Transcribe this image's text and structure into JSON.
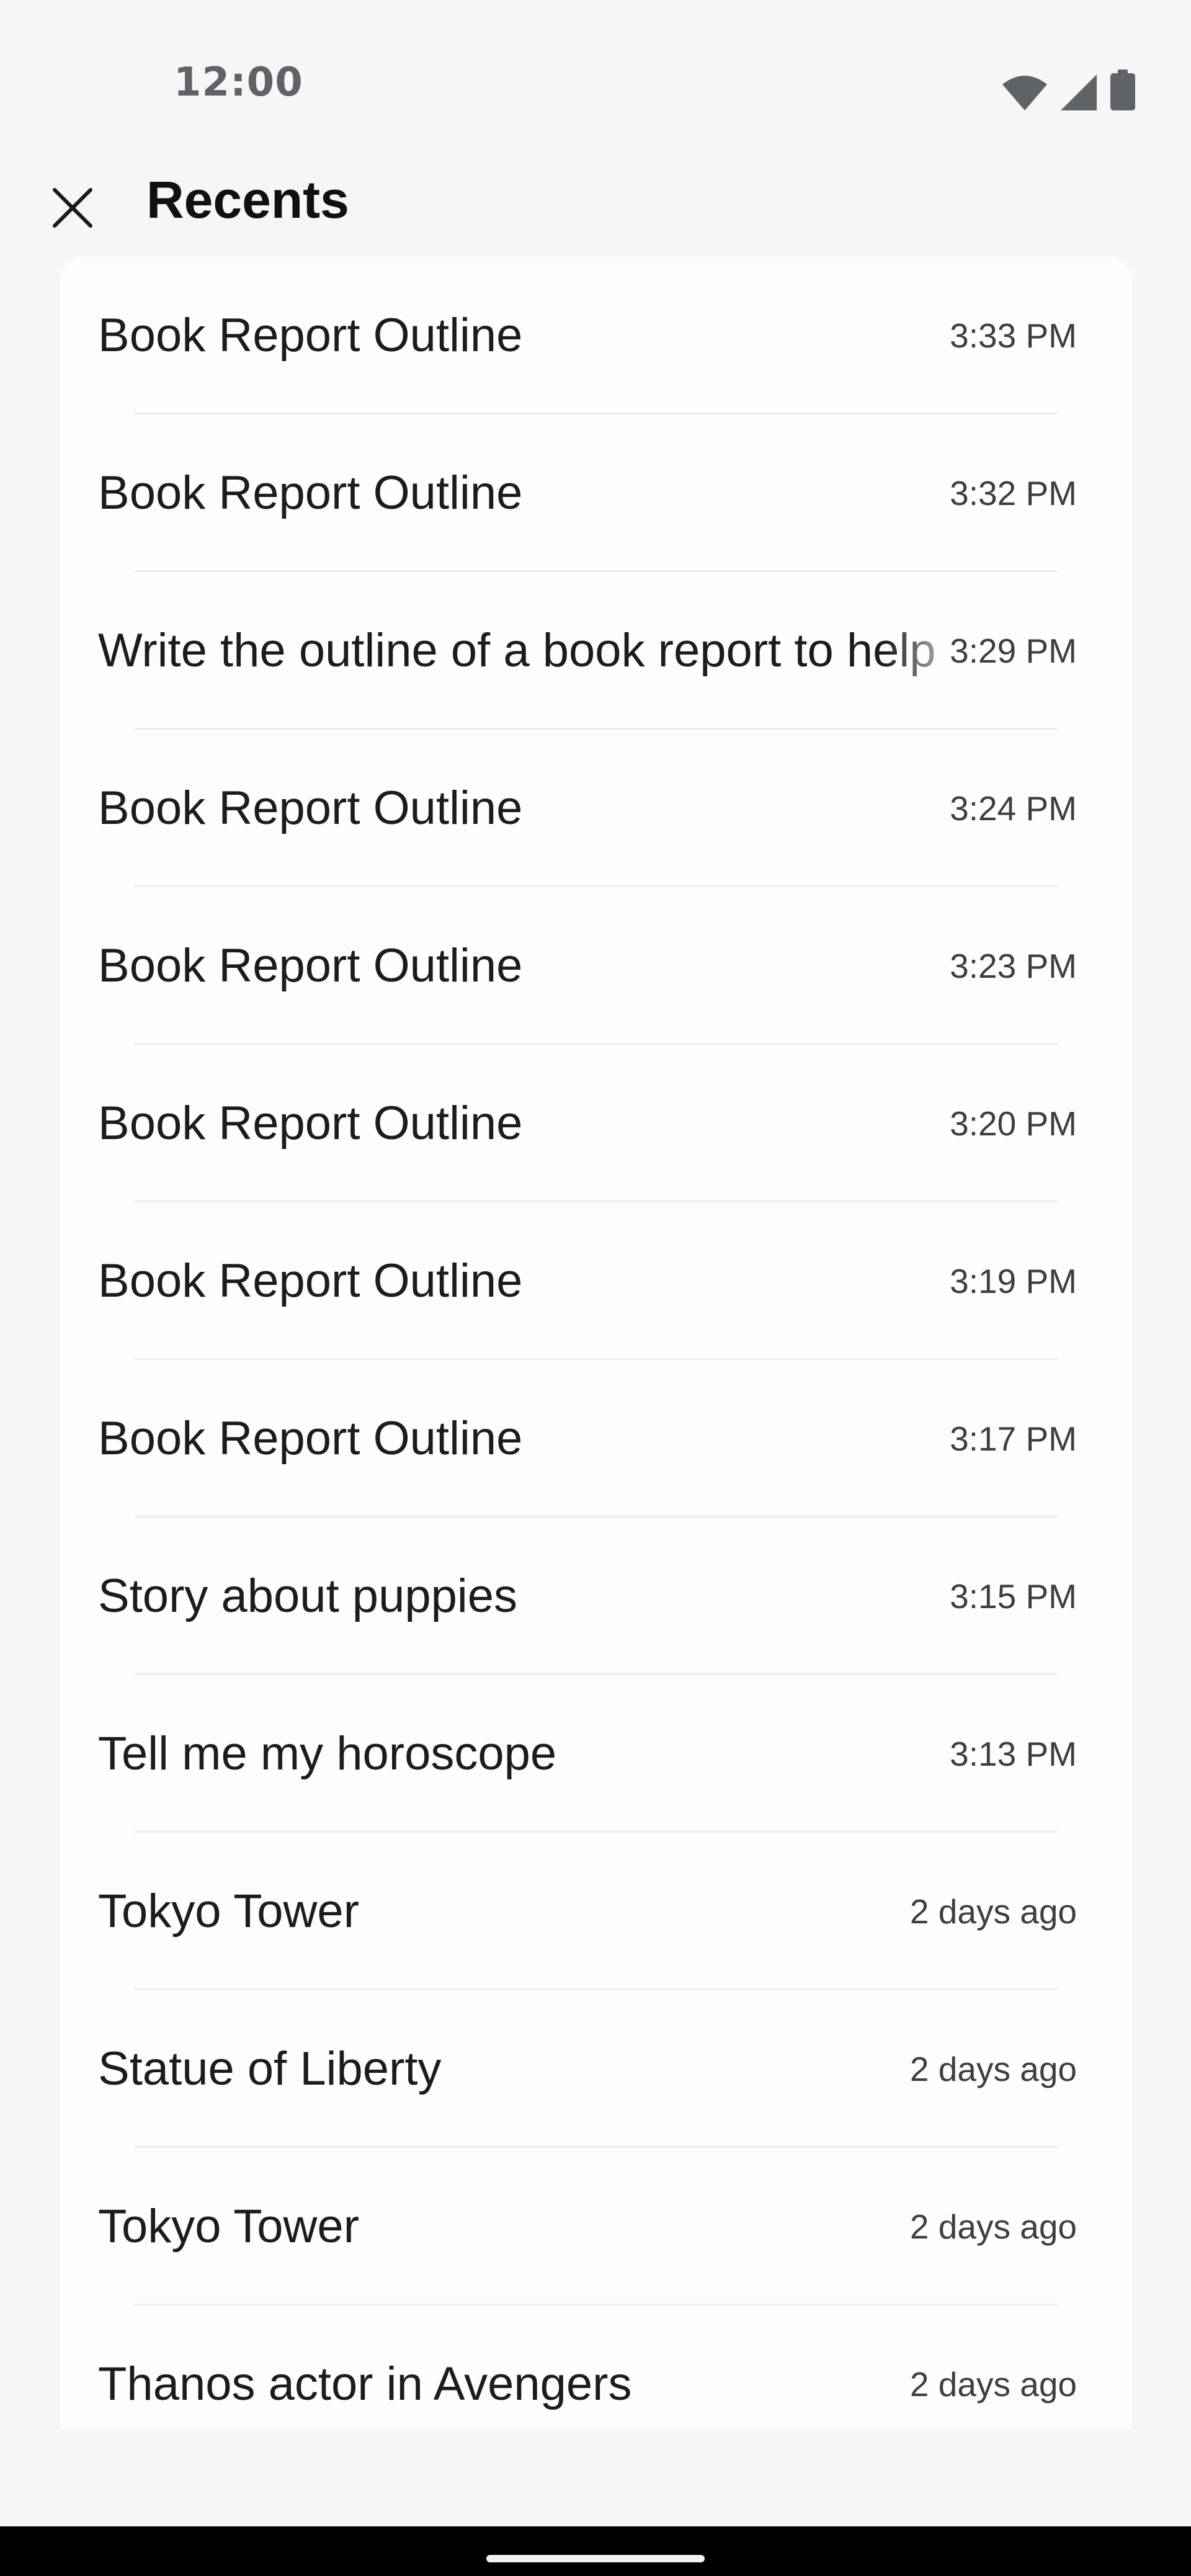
{
  "status_bar": {
    "time": "12:00",
    "icons": [
      "wifi-icon",
      "cellular-signal-icon",
      "battery-icon"
    ]
  },
  "app_bar": {
    "close_icon": "close-icon",
    "title": "Recents"
  },
  "recents": [
    {
      "title": "Book Report Outline",
      "time": "3:33 PM"
    },
    {
      "title": "Book Report Outline",
      "time": "3:32 PM"
    },
    {
      "title": "Write the outline of a book report to help",
      "time": "3:29 PM"
    },
    {
      "title": "Book Report Outline",
      "time": "3:24 PM"
    },
    {
      "title": "Book Report Outline",
      "time": "3:23 PM"
    },
    {
      "title": "Book Report Outline",
      "time": "3:20 PM"
    },
    {
      "title": "Book Report Outline",
      "time": "3:19 PM"
    },
    {
      "title": "Book Report Outline",
      "time": "3:17 PM"
    },
    {
      "title": "Story about puppies",
      "time": "3:15 PM"
    },
    {
      "title": "Tell me my horoscope",
      "time": "3:13 PM"
    },
    {
      "title": "Tokyo Tower",
      "time": "2 days ago"
    },
    {
      "title": "Statue of Liberty",
      "time": "2 days ago"
    },
    {
      "title": "Tokyo Tower",
      "time": "2 days ago"
    },
    {
      "title": "Thanos actor in Avengers",
      "time": "2 days ago"
    }
  ],
  "colors": {
    "background": "#f6f6f6",
    "card": "#fdfdfd",
    "nav_bar": "#000000"
  }
}
